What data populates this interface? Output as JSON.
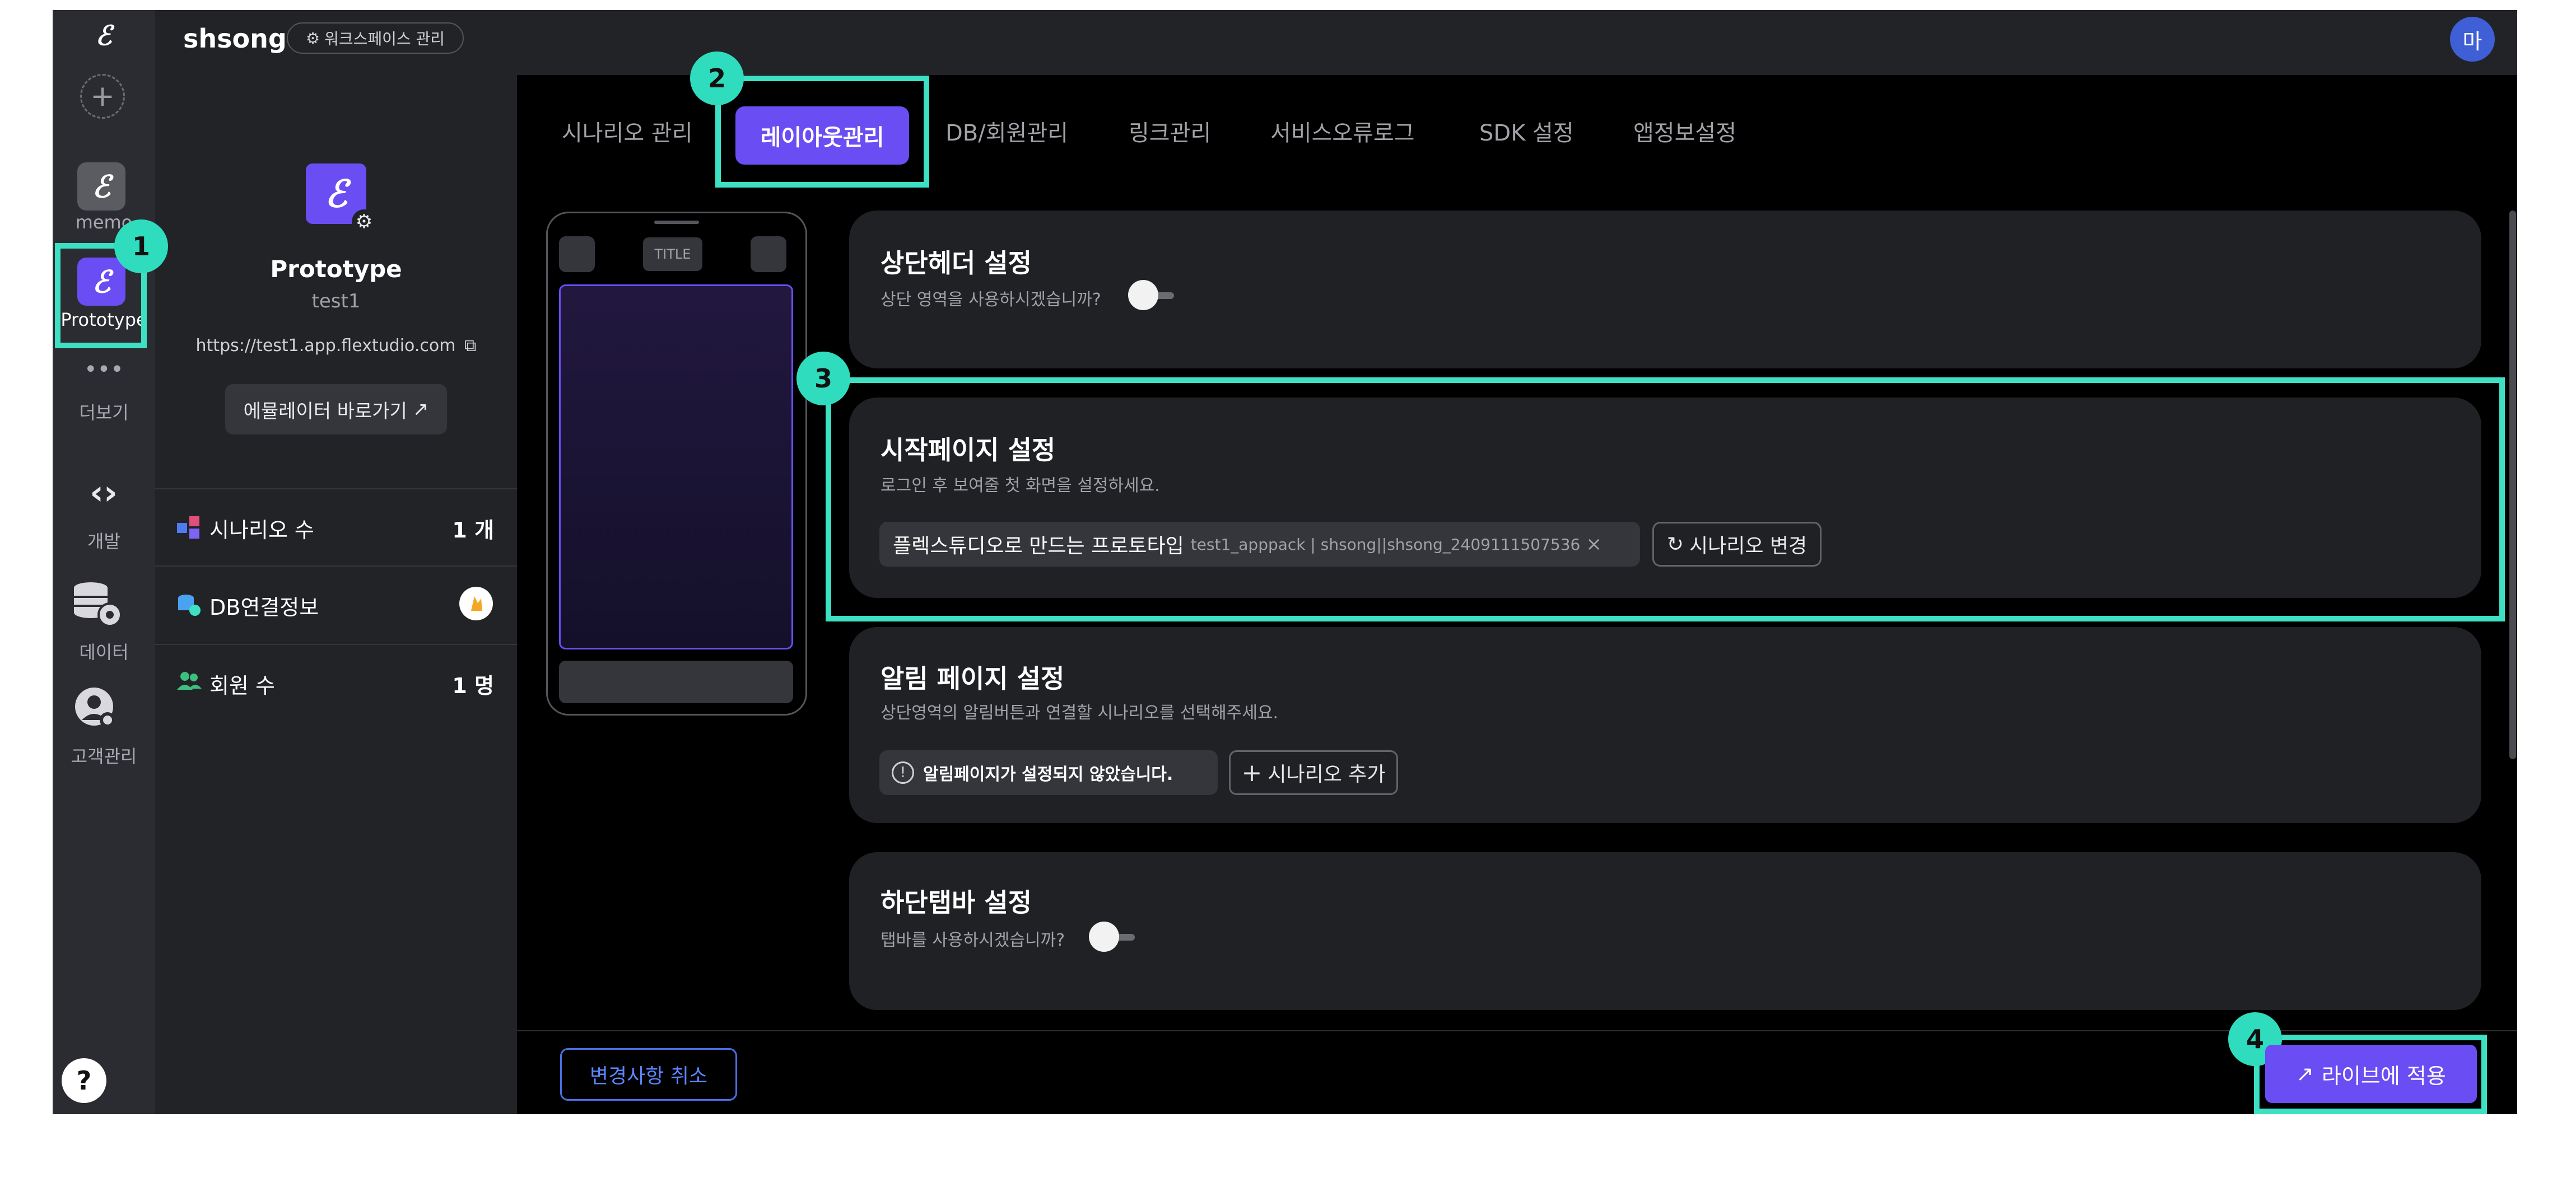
{
  "header": {
    "workspace_name": "shsong",
    "workspace_manage": "워크스페이스 관리",
    "avatar_initial": "마"
  },
  "rail": {
    "items": [
      {
        "label": "memo",
        "icon": "flexstudio-logo-icon"
      },
      {
        "label": "Prototype",
        "icon": "flexstudio-logo-icon"
      },
      {
        "label": "더보기",
        "icon": "more-dots-icon"
      },
      {
        "label": "개발",
        "icon": "code-brackets-icon"
      },
      {
        "label": "데이터",
        "icon": "database-gear-icon"
      },
      {
        "label": "고객관리",
        "icon": "user-settings-icon"
      }
    ],
    "help": "?"
  },
  "project": {
    "name": "Prototype",
    "id": "test1",
    "url": "https://test1.app.flextudio.com",
    "emulator_button": "에뮬레이터 바로가기",
    "stats": [
      {
        "label": "시나리오 수",
        "value": "1 개",
        "icon": "scenario-blocks-icon"
      },
      {
        "label": "DB연결정보",
        "value": "",
        "icon": "database-link-icon"
      },
      {
        "label": "회원 수",
        "value": "1 명",
        "icon": "users-icon"
      }
    ]
  },
  "tabs": {
    "items": [
      "시나리오 관리",
      "레이아웃관리",
      "DB/회원관리",
      "링크관리",
      "서비스오류로그",
      "SDK 설정",
      "앱정보설정"
    ],
    "active": "레이아웃관리"
  },
  "phone_preview": {
    "title_placeholder": "TITLE"
  },
  "sections": {
    "header_setting": {
      "title": "상단헤더 설정",
      "subtitle": "상단 영역을 사용하시겠습니까?",
      "enabled": false
    },
    "start_page": {
      "title": "시작페이지 설정",
      "subtitle": "로그인 후 보여줄 첫 화면을 설정하세요.",
      "scenario_name": "플렉스튜디오로 만드는 프로토타입",
      "scenario_meta": "test1_apppack | shsong||shsong_2409111507536",
      "change_button": "시나리오 변경"
    },
    "notification_page": {
      "title": "알림 페이지 설정",
      "subtitle": "상단영역의 알림버튼과 연결할 시나리오를 선택해주세요.",
      "warning": "알림페이지가 설정되지 않았습니다.",
      "add_button": "시나리오 추가"
    },
    "bottom_tab": {
      "title": "하단탭바 설정",
      "subtitle": "탭바를 사용하시겠습니까?",
      "enabled": false
    }
  },
  "footer": {
    "cancel_button": "변경사항 취소",
    "apply_button": "라이브에 적용"
  },
  "annotations": [
    "1",
    "2",
    "3",
    "4"
  ],
  "colors": {
    "accent": "#6a4df3",
    "highlight": "#3de0c3",
    "background": "#000000",
    "panel": "#222327"
  }
}
